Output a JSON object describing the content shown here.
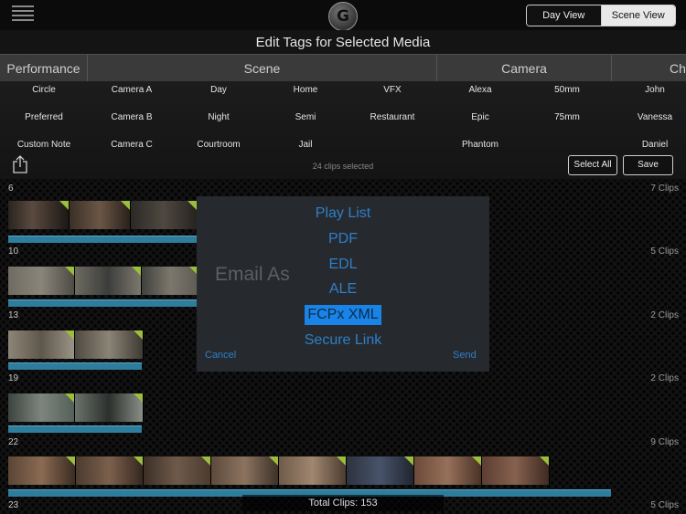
{
  "topbar": {
    "day_view": "Day View",
    "scene_view": "Scene View",
    "logo_glyph": "G"
  },
  "title": "Edit Tags for Selected Media",
  "categories": [
    "Performance",
    "Scene",
    "Camera",
    "Cha"
  ],
  "tags": {
    "performance": [
      "Circle",
      "Preferred",
      "Custom Note"
    ],
    "scene_col1": [
      "Camera A",
      "Camera B",
      "Camera C"
    ],
    "scene_col2": [
      "Day",
      "Night",
      "Courtroom"
    ],
    "scene_col3": [
      "Home",
      "Semi",
      "Jail"
    ],
    "scene_col4": [
      "VFX",
      "Restaurant"
    ],
    "camera_col1": [
      "Alexa",
      "Epic",
      "Phantom"
    ],
    "camera_col2": [
      "50mm",
      "75mm"
    ],
    "character": [
      "John",
      "Vanessa",
      "Daniel"
    ]
  },
  "clips_selected": "24 clips selected",
  "buttons": {
    "select_all": "Select All",
    "save": "Save"
  },
  "rows": [
    {
      "label": "6",
      "count": "7 Clips"
    },
    {
      "label": "10",
      "count": "5 Clips"
    },
    {
      "label": "13",
      "count": "2 Clips"
    },
    {
      "label": "19",
      "count": "2 Clips"
    },
    {
      "label": "22",
      "count": "9 Clips"
    },
    {
      "label": "23",
      "count": "5 Clips"
    }
  ],
  "popup": {
    "title": "Email As",
    "options": [
      "Play List",
      "PDF",
      "EDL",
      "ALE",
      "FCPx XML",
      "Secure Link"
    ],
    "selected": "FCPx XML",
    "cancel": "Cancel",
    "send": "Send"
  },
  "total_clips": "Total Clips: 153",
  "colors": {
    "accent_blue": "#2e7fc8",
    "selected_blue": "#1a83e8",
    "tag_green": "#9bbf3a",
    "timeline_blue": "#2f7d9c"
  }
}
